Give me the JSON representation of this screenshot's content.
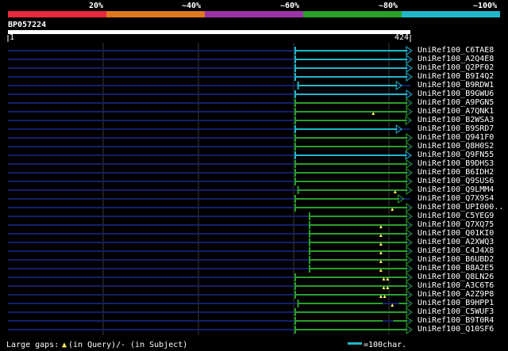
{
  "scale": {
    "labels": [
      "20%",
      "~40%",
      "~60%",
      "~80%",
      "~100%"
    ],
    "colors": [
      "#e8283c",
      "#e07820",
      "#9b33a8",
      "#2aa02a",
      "#20b8c8"
    ]
  },
  "query": {
    "id": "BP057224",
    "start": "1",
    "end": "424",
    "length": 424
  },
  "hits": [
    {
      "name": "UniRef100_C6TAE8",
      "start": 303,
      "end": 480,
      "color": "#20b8c8",
      "marks": [],
      "gaps": []
    },
    {
      "name": "UniRef100_A2Q4E8",
      "start": 303,
      "end": 480,
      "color": "#20b8c8",
      "marks": [],
      "gaps": []
    },
    {
      "name": "UniRef100_Q2PF02",
      "start": 303,
      "end": 480,
      "color": "#20b8c8",
      "marks": [],
      "gaps": []
    },
    {
      "name": "UniRef100_B9I4Q2",
      "start": 303,
      "end": 480,
      "color": "#20b8c8",
      "marks": [],
      "gaps": []
    },
    {
      "name": "UniRef100_B9RDW1",
      "start": 306,
      "end": 410,
      "color": "#20b8c8",
      "marks": [],
      "gaps": []
    },
    {
      "name": "UniRef100_B9GWU6",
      "start": 303,
      "end": 480,
      "color": "#20b8c8",
      "marks": [],
      "gaps": []
    },
    {
      "name": "UniRef100_A9PGN5",
      "start": 303,
      "end": 480,
      "color": "#2aa02a",
      "marks": [],
      "gaps": []
    },
    {
      "name": "UniRef100_A7QNK1",
      "start": 303,
      "end": 480,
      "color": "#2aa02a",
      "marks": [
        385
      ],
      "gaps": []
    },
    {
      "name": "UniRef100_B2WSA3",
      "start": 303,
      "end": 420,
      "color": "#2aa02a",
      "marks": [],
      "gaps": []
    },
    {
      "name": "UniRef100_B9SRD7",
      "start": 303,
      "end": 410,
      "color": "#20b8c8",
      "marks": [],
      "gaps": []
    },
    {
      "name": "UniRef100_Q941F0",
      "start": 303,
      "end": 480,
      "color": "#2aa02a",
      "marks": [],
      "gaps": []
    },
    {
      "name": "UniRef100_Q8H0S2",
      "start": 303,
      "end": 480,
      "color": "#2aa02a",
      "marks": [],
      "gaps": []
    },
    {
      "name": "UniRef100_Q9FN55",
      "start": 303,
      "end": 420,
      "color": "#20b8c8",
      "marks": [],
      "gaps": []
    },
    {
      "name": "UniRef100_B9DHS3",
      "start": 303,
      "end": 480,
      "color": "#2aa02a",
      "marks": [],
      "gaps": []
    },
    {
      "name": "UniRef100_B6IDH2",
      "start": 303,
      "end": 480,
      "color": "#2aa02a",
      "marks": [],
      "gaps": []
    },
    {
      "name": "UniRef100_Q9SUS6",
      "start": 303,
      "end": 480,
      "color": "#2aa02a",
      "marks": [],
      "gaps": []
    },
    {
      "name": "UniRef100_Q9LMM4",
      "start": 306,
      "end": 480,
      "color": "#2aa02a",
      "marks": [
        408
      ],
      "gaps": []
    },
    {
      "name": "UniRef100_Q7X9S4",
      "start": 303,
      "end": 412,
      "color": "#2aa02a",
      "marks": [],
      "gaps": []
    },
    {
      "name": "UniRef100_UPI000..",
      "start": 303,
      "end": 480,
      "color": "#2aa02a",
      "marks": [
        405
      ],
      "gaps": []
    },
    {
      "name": "UniRef100_C5YEG9",
      "start": 318,
      "end": 424,
      "color": "#2aa02a",
      "marks": [],
      "gaps": []
    },
    {
      "name": "UniRef100_Q7XQ75",
      "start": 318,
      "end": 424,
      "color": "#2aa02a",
      "marks": [
        393
      ],
      "gaps": []
    },
    {
      "name": "UniRef100_Q01KI0",
      "start": 318,
      "end": 424,
      "color": "#2aa02a",
      "marks": [
        393
      ],
      "gaps": []
    },
    {
      "name": "UniRef100_A2XWQ3",
      "start": 318,
      "end": 424,
      "color": "#2aa02a",
      "marks": [
        393
      ],
      "gaps": []
    },
    {
      "name": "UniRef100_C4J4X8",
      "start": 318,
      "end": 424,
      "color": "#2aa02a",
      "marks": [
        393
      ],
      "gaps": []
    },
    {
      "name": "UniRef100_B6UBD2",
      "start": 318,
      "end": 424,
      "color": "#2aa02a",
      "marks": [
        393
      ],
      "gaps": []
    },
    {
      "name": "UniRef100_B8A2E5",
      "start": 318,
      "end": 424,
      "color": "#2aa02a",
      "marks": [
        393
      ],
      "gaps": []
    },
    {
      "name": "UniRef100_Q8LN26",
      "start": 303,
      "end": 424,
      "color": "#2aa02a",
      "marks": [
        396,
        400
      ],
      "gaps": []
    },
    {
      "name": "UniRef100_A3C6T6",
      "start": 303,
      "end": 424,
      "color": "#2aa02a",
      "marks": [
        396,
        400
      ],
      "gaps": []
    },
    {
      "name": "UniRef100_A2Z9P8",
      "start": 303,
      "end": 424,
      "color": "#2aa02a",
      "marks": [
        393,
        397
      ],
      "gaps": []
    },
    {
      "name": "UniRef100_B9HPP1",
      "start": 306,
      "end": 480,
      "color": "#2aa02a",
      "marks": [
        405
      ],
      "gaps": [
        [
          395,
          412
        ]
      ]
    },
    {
      "name": "UniRef100_C5WUF3",
      "start": 303,
      "end": 424,
      "color": "#2aa02a",
      "marks": [],
      "gaps": []
    },
    {
      "name": "UniRef100_B9T0R4",
      "start": 303,
      "end": 480,
      "color": "#2aa02a",
      "marks": [],
      "gaps": [
        [
          395,
          406
        ]
      ]
    },
    {
      "name": "UniRef100_Q10SF6",
      "start": 303,
      "end": 424,
      "color": "#2aa02a",
      "marks": [],
      "gaps": []
    }
  ],
  "legend": {
    "gap_label": "Large gaps:",
    "query_label": "(in Query)/",
    "subject_label": "- (in Subject)",
    "scale_label": "=100char."
  }
}
